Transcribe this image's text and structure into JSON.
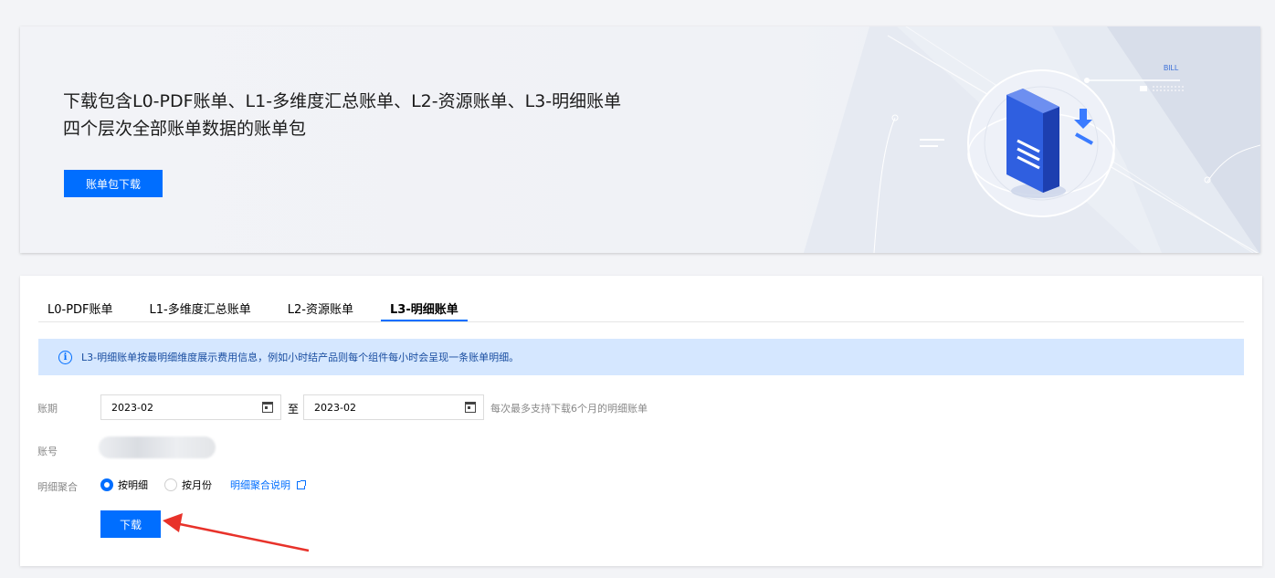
{
  "banner": {
    "line1": "下载包含L0-PDF账单、L1-多维度汇总账单、L2-资源账单、L3-明细账单",
    "line2": "四个层次全部账单数据的账单包",
    "button_label": "账单包下载",
    "illustration_tag": "BILL"
  },
  "tabs": [
    {
      "label": "L0-PDF账单",
      "active": false
    },
    {
      "label": "L1-多维度汇总账单",
      "active": false
    },
    {
      "label": "L2-资源账单",
      "active": false
    },
    {
      "label": "L3-明细账单",
      "active": true
    }
  ],
  "alert": {
    "icon": "info-icon",
    "text": "L3-明细账单按最明细维度展示费用信息，例如小时结产品则每个组件每小时会呈现一条账单明细。"
  },
  "form": {
    "period_label": "账期",
    "start_month": "2023-02",
    "to_label": "至",
    "end_month": "2023-02",
    "period_hint": "每次最多支持下载6个月的明细账单",
    "account_label": "账号",
    "aggregation_label": "明细聚合",
    "option_detail": "按明细",
    "option_month": "按月份",
    "selected_option": "按明细",
    "aggregation_help_link": "明细聚合说明",
    "download_label": "下载"
  },
  "colors": {
    "primary": "#006eff",
    "alert_bg": "#d5e7ff",
    "annotation_arrow": "#e8322a"
  }
}
